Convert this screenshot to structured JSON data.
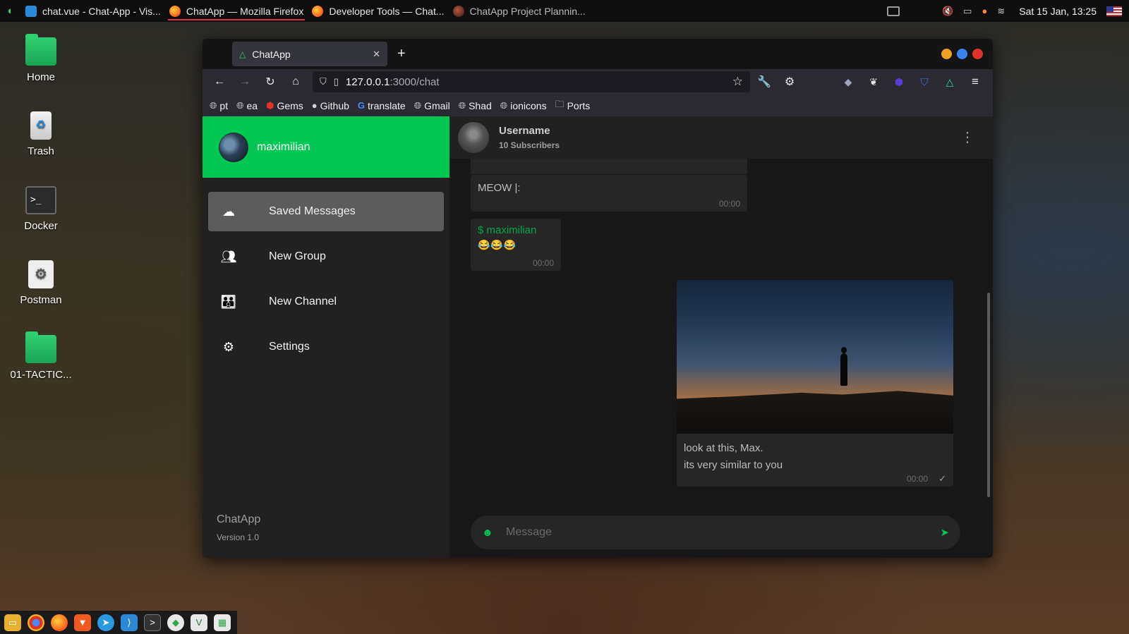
{
  "topbar": {
    "tasks": [
      {
        "label": "chat.vue - Chat-App - Vis...",
        "icon": "vscode-icon",
        "color": "#2b8ad8"
      },
      {
        "label": "ChatApp — Mozilla Firefox",
        "icon": "firefox-icon",
        "color": "#ff8a1f"
      },
      {
        "label": "Developer Tools — Chat...",
        "icon": "firefox-icon",
        "color": "#ff8a1f"
      },
      {
        "label": "ChatApp Project Plannin...",
        "icon": "firefox-icon",
        "color": "#8a3a2a"
      }
    ],
    "clock": "Sat 15 Jan, 13:25"
  },
  "desktop": {
    "icons": [
      {
        "label": "Home",
        "icon": "home-folder-icon"
      },
      {
        "label": "Trash",
        "icon": "trash-icon"
      },
      {
        "label": "Docker",
        "icon": "terminal-icon"
      },
      {
        "label": "Postman",
        "icon": "settings-doc-icon"
      },
      {
        "label": "01-TACTIC...",
        "icon": "folder-icon"
      }
    ]
  },
  "browser": {
    "tab_title": "ChatApp",
    "url_host": "127.0.0.1",
    "url_path": ":3000/chat",
    "bookmarks": [
      {
        "label": "pt",
        "icon": "globe-icon"
      },
      {
        "label": "ea",
        "icon": "globe-icon"
      },
      {
        "label": "Gems",
        "icon": "ruby-icon"
      },
      {
        "label": "Github",
        "icon": "github-icon"
      },
      {
        "label": "translate",
        "icon": "google-icon"
      },
      {
        "label": "Gmail",
        "icon": "globe-icon"
      },
      {
        "label": "Shad",
        "icon": "globe-icon"
      },
      {
        "label": "ionicons",
        "icon": "globe-icon"
      },
      {
        "label": "Ports",
        "icon": "folder-icon"
      }
    ]
  },
  "sidebar": {
    "username": "maximilian",
    "items": [
      {
        "label": "Saved Messages",
        "icon": "cloud-icon",
        "active": true
      },
      {
        "label": "New Group",
        "icon": "group-icon",
        "active": false
      },
      {
        "label": "New Channel",
        "icon": "channel-icon",
        "active": false
      },
      {
        "label": "Settings",
        "icon": "gear-icon",
        "active": false
      }
    ],
    "brand": "ChatApp",
    "version": "Version 1.0"
  },
  "chat": {
    "name": "Username",
    "subscribers": "10 Subscribers",
    "messages": [
      {
        "text": "MEOW |:",
        "time": "00:00"
      },
      {
        "sender": "$ maximilian",
        "text": "😂😂😂",
        "time": "00:00"
      },
      {
        "caption_line1": "look at this, Max.",
        "caption_line2": "its very similar to you",
        "time": "00:00"
      }
    ],
    "composer_placeholder": "Message"
  },
  "colors": {
    "accent": "#00c853",
    "sidebar_bg": "#212121",
    "chat_bg": "#181818"
  }
}
